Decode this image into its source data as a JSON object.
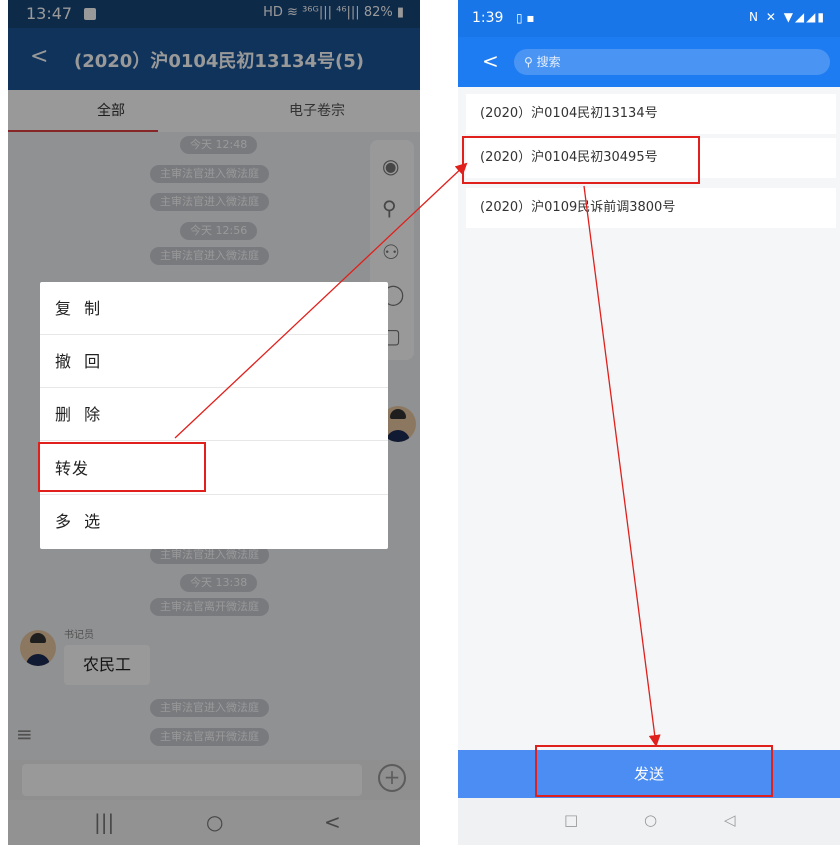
{
  "left": {
    "status_time": "13:47",
    "status_signal": "HD ≋ ³⁶ᴳ||| ⁴⁶||| 82% ▮",
    "header_back": "<",
    "header_title": "(2020）沪0104民初13134号(5)",
    "tabs": [
      "全部",
      "电子卷宗"
    ],
    "chat": {
      "pills": [
        "今天 12:48",
        "主审法官进入微法庭",
        "主审法官进入微法庭",
        "今天 12:56",
        "主审法官进入微法庭",
        "主审法官进入微法庭",
        "今天 13:38",
        "主审法官离开微法庭",
        "主审法官进入微法庭",
        "主审法官离开微法庭"
      ],
      "sender": "书记员",
      "message": "农民工"
    },
    "context_menu": [
      "复 制",
      "撤 回",
      "删 除",
      "转发",
      "多 选"
    ],
    "nav": [
      "|||",
      "○",
      "<"
    ],
    "plus_icon": "+"
  },
  "right": {
    "status_time": "1:39",
    "status_icons": "▯ ▪",
    "status_signal": "N ✕ ▼◢◢▮",
    "header_back": "<",
    "search_placeholder": "搜索",
    "cases": [
      "(2020）沪0104民初13134号",
      "(2020）沪0104民初30495号",
      "(2020）沪0109民诉前调3800号"
    ],
    "send_label": "发送",
    "nav": [
      "□",
      "○",
      "◁"
    ]
  },
  "colors": {
    "left_header": "#1a5597",
    "right_header": "#1e7cf2",
    "send_bar": "#4b8df3",
    "annotation": "#e0201c"
  }
}
